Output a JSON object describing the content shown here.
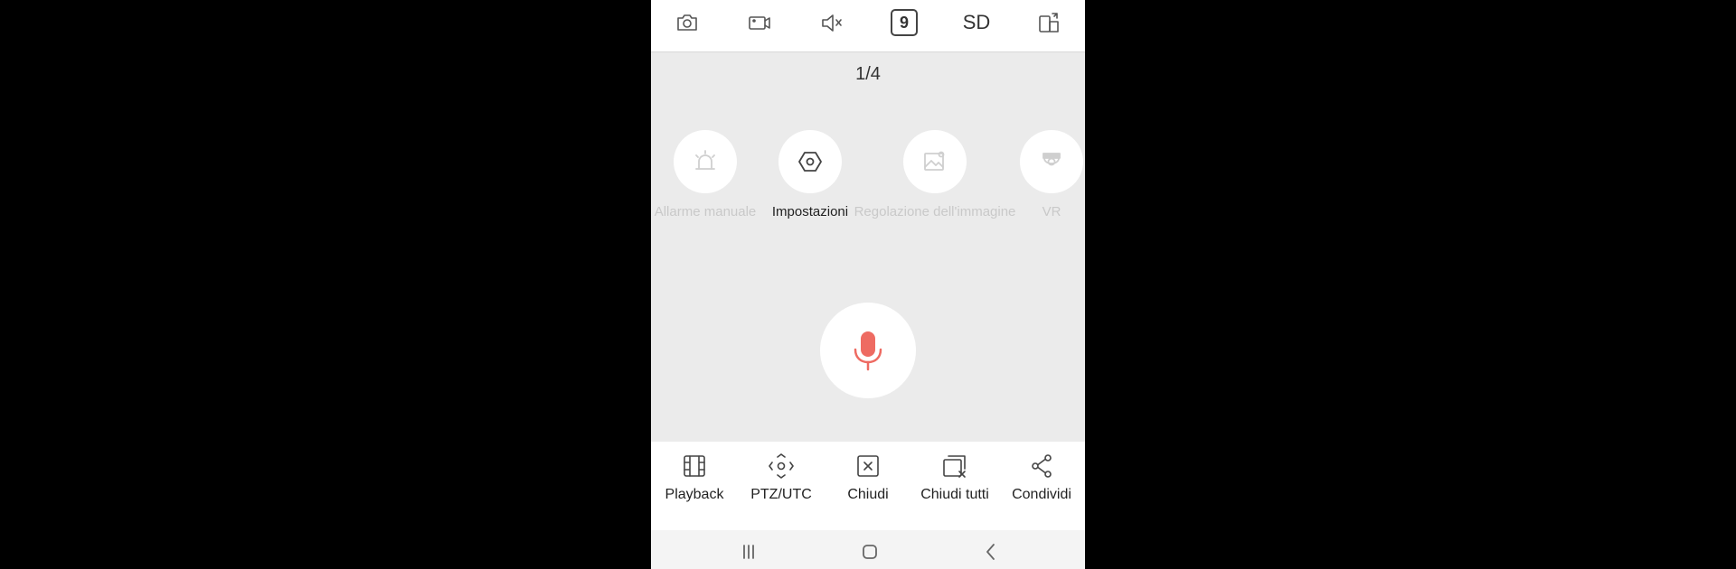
{
  "top_toolbar": {
    "snapshot_icon": "camera-icon",
    "record_icon": "video-record-icon",
    "audio_icon": "speaker-muted-icon",
    "layout_count": "9",
    "quality": "SD",
    "rotate_icon": "rotate-screen-icon"
  },
  "pager": {
    "text": "1/4"
  },
  "actions": [
    {
      "label": "Allarme manuale",
      "icon": "alarm-siren-icon",
      "enabled": false
    },
    {
      "label": "Impostazioni",
      "icon": "settings-hexagon-icon",
      "enabled": true
    },
    {
      "label": "Regolazione dell'immagine",
      "icon": "image-adjust-icon",
      "enabled": false
    },
    {
      "label": "VR",
      "icon": "fisheye-camera-icon",
      "enabled": false
    }
  ],
  "talk": {
    "icon": "microphone-icon",
    "color": "#ee6b62"
  },
  "bottom_toolbar": [
    {
      "label": "Playback",
      "icon": "film-icon"
    },
    {
      "label": "PTZ/UTC",
      "icon": "ptz-control-icon"
    },
    {
      "label": "Chiudi",
      "icon": "close-box-icon"
    },
    {
      "label": "Chiudi tutti",
      "icon": "close-all-icon"
    },
    {
      "label": "Condividi",
      "icon": "share-icon"
    }
  ],
  "nav_bar": {
    "recents_icon": "recents-icon",
    "home_icon": "home-icon",
    "back_icon": "back-icon"
  }
}
